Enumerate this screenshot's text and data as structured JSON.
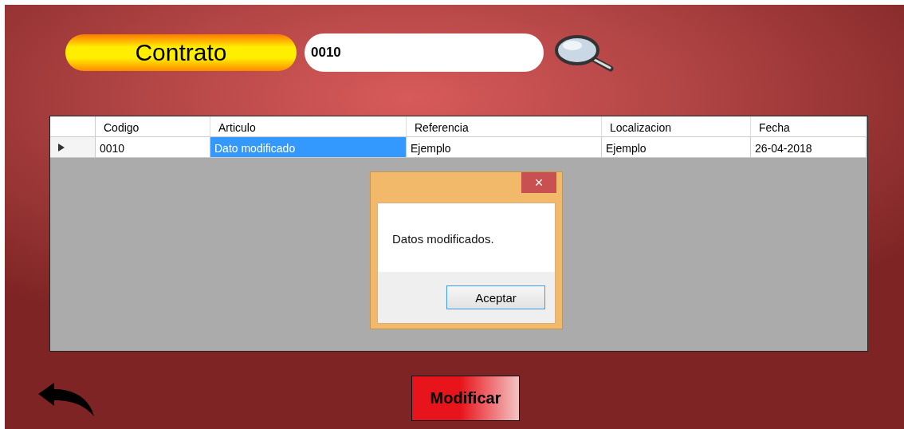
{
  "contract_label": "Contrato",
  "contract_field": {
    "value": "0010"
  },
  "table": {
    "columns": [
      "Codigo",
      "Articulo",
      "Referencia",
      "Localizacion",
      "Fecha"
    ],
    "rows": [
      {
        "current": true,
        "cells": [
          {
            "text": "0010",
            "selected": false
          },
          {
            "text": "Dato modificado",
            "selected": true
          },
          {
            "text": "Ejemplo",
            "selected": false
          },
          {
            "text": "Ejemplo",
            "selected": false
          },
          {
            "text": "26-04-2018",
            "selected": false
          }
        ]
      }
    ]
  },
  "dialog": {
    "close": "×",
    "message": "Datos modificados.",
    "button": "Aceptar"
  },
  "modify_button": "Modificar"
}
